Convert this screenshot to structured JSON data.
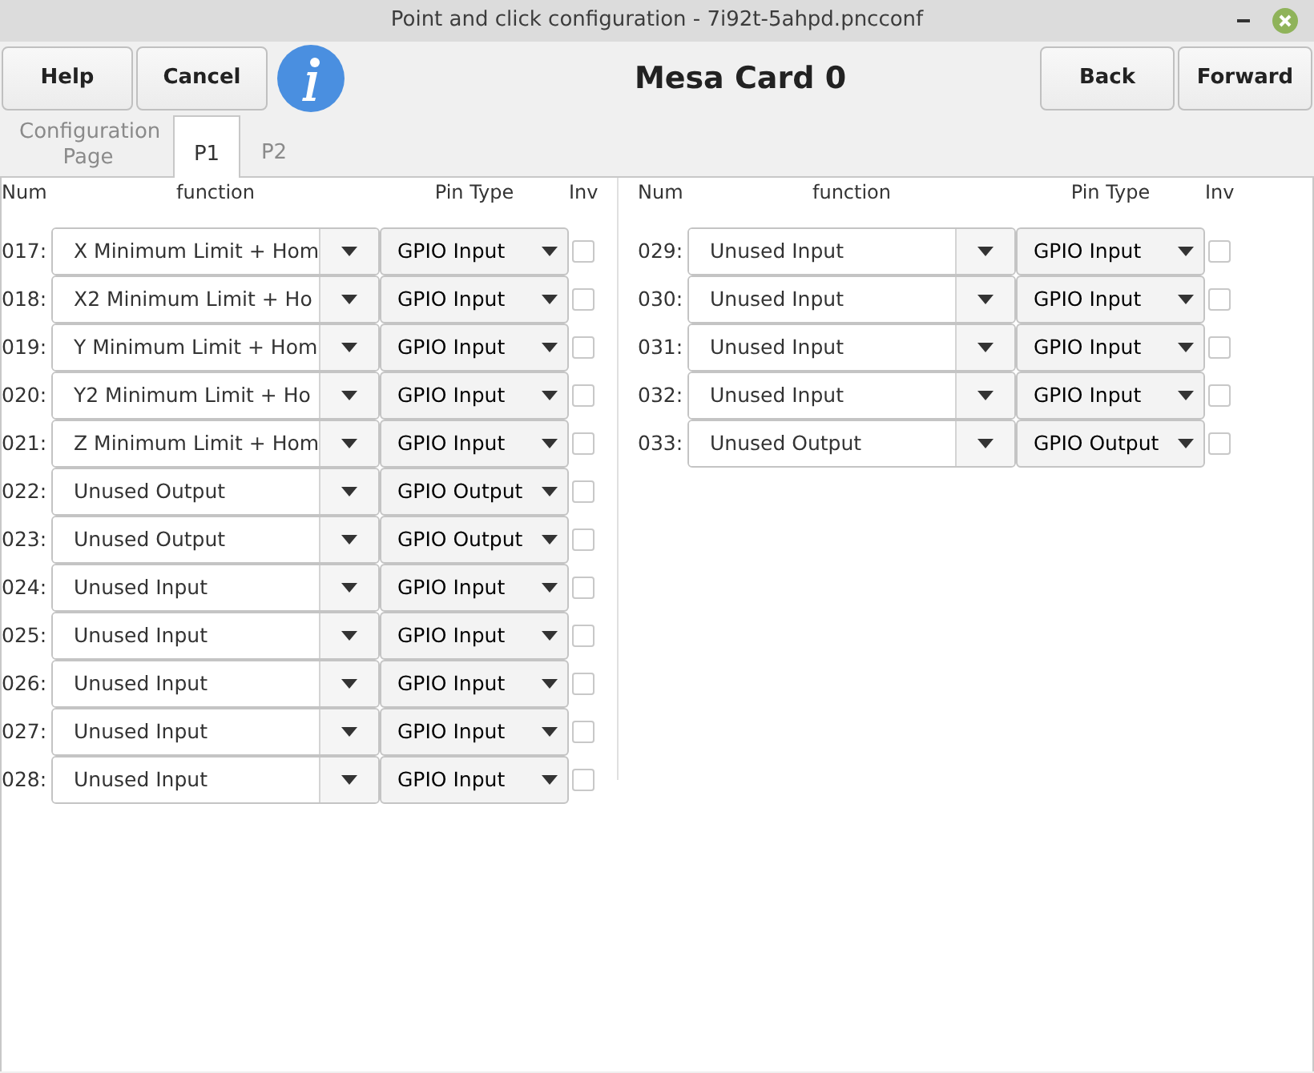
{
  "window": {
    "title": "Point and click configuration - 7i92t-5ahpd.pncconf"
  },
  "toolbar": {
    "left_buttons": [
      "Help",
      "Cancel"
    ],
    "heading": "Mesa Card 0",
    "right_buttons": [
      "Back",
      "Forward"
    ]
  },
  "tabs": [
    {
      "label": "Configuration Page",
      "selected": false
    },
    {
      "label": "P1",
      "selected": true
    },
    {
      "label": "P2",
      "selected": false
    }
  ],
  "pin_groups": [
    {
      "headers": [
        "Num",
        "function",
        "Pin Type",
        "Inv"
      ],
      "rows": [
        {
          "num": "017:",
          "function": "X Minimum Limit + Hom",
          "pin_type": "GPIO Input",
          "inverted": false
        },
        {
          "num": "018:",
          "function": "X2 Minimum Limit + Ho",
          "pin_type": "GPIO Input",
          "inverted": false
        },
        {
          "num": "019:",
          "function": "Y Minimum Limit + Hom",
          "pin_type": "GPIO Input",
          "inverted": false
        },
        {
          "num": "020:",
          "function": "Y2 Minimum Limit + Ho",
          "pin_type": "GPIO Input",
          "inverted": false
        },
        {
          "num": "021:",
          "function": "Z Minimum Limit + Hom",
          "pin_type": "GPIO Input",
          "inverted": false
        },
        {
          "num": "022:",
          "function": "Unused Output",
          "pin_type": "GPIO Output",
          "inverted": false
        },
        {
          "num": "023:",
          "function": "Unused Output",
          "pin_type": "GPIO Output",
          "inverted": false
        },
        {
          "num": "024:",
          "function": "Unused Input",
          "pin_type": "GPIO Input",
          "inverted": false
        },
        {
          "num": "025:",
          "function": "Unused Input",
          "pin_type": "GPIO Input",
          "inverted": false
        },
        {
          "num": "026:",
          "function": "Unused Input",
          "pin_type": "GPIO Input",
          "inverted": false
        },
        {
          "num": "027:",
          "function": "Unused Input",
          "pin_type": "GPIO Input",
          "inverted": false
        },
        {
          "num": "028:",
          "function": "Unused Input",
          "pin_type": "GPIO Input",
          "inverted": false
        }
      ]
    },
    {
      "headers": [
        "Num",
        "function",
        "Pin Type",
        "Inv"
      ],
      "rows": [
        {
          "num": "029:",
          "function": "Unused Input",
          "pin_type": "GPIO Input",
          "inverted": false
        },
        {
          "num": "030:",
          "function": "Unused Input",
          "pin_type": "GPIO Input",
          "inverted": false
        },
        {
          "num": "031:",
          "function": "Unused Input",
          "pin_type": "GPIO Input",
          "inverted": false
        },
        {
          "num": "032:",
          "function": "Unused Input",
          "pin_type": "GPIO Input",
          "inverted": false
        },
        {
          "num": "033:",
          "function": "Unused Output",
          "pin_type": "GPIO Output",
          "inverted": false
        }
      ]
    }
  ]
}
